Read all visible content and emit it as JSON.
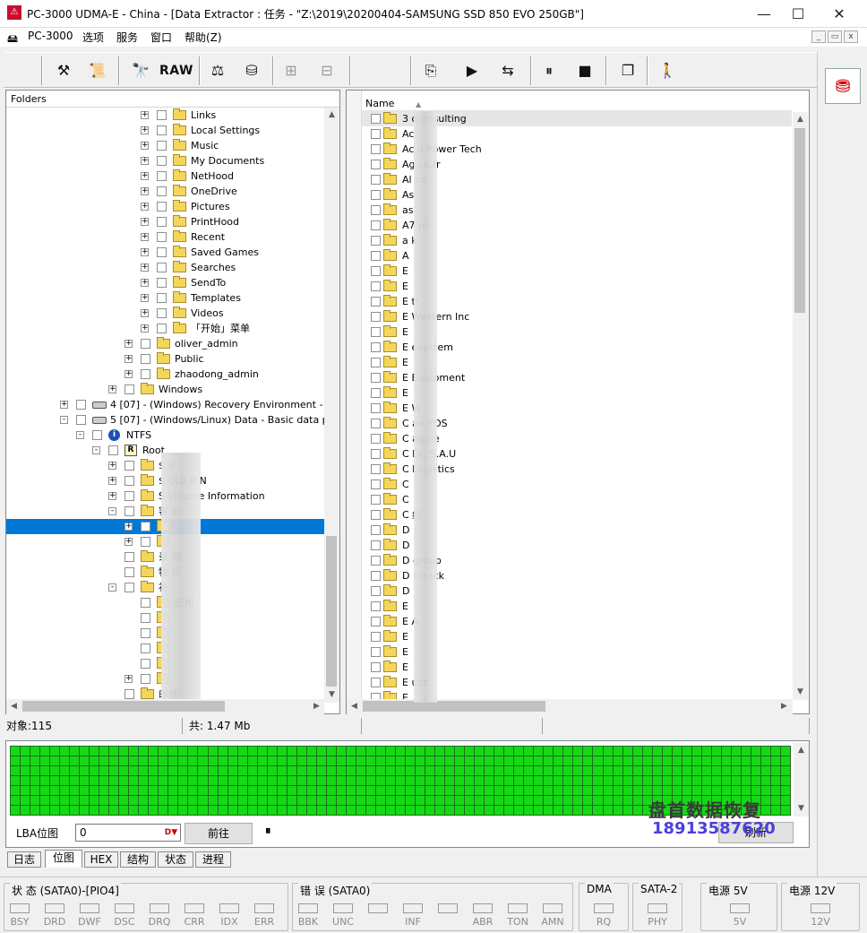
{
  "window": {
    "title": "PC-3000 UDMA-E - China - [Data Extractor : 任务 - \"Z:\\2019\\20200404-SAMSUNG SSD 850 EVO 250GB\"]",
    "minimize": "—",
    "maximize": "☐",
    "close": "✕"
  },
  "menu": {
    "items": [
      "PC-3000",
      "选项",
      "服务",
      "窗口",
      "帮助(Z)"
    ],
    "mdi_minimize": "_",
    "mdi_restore": "▭",
    "mdi_close": "x"
  },
  "toolbar": {
    "raw_label": "RAW"
  },
  "folders": {
    "header": "Folders",
    "rows": [
      {
        "label": "Links"
      },
      {
        "label": "Local Settings"
      },
      {
        "label": "Music"
      },
      {
        "label": "My Documents"
      },
      {
        "label": "NetHood"
      },
      {
        "label": "OneDrive"
      },
      {
        "label": "Pictures"
      },
      {
        "label": "PrintHood"
      },
      {
        "label": "Recent"
      },
      {
        "label": "Saved Games"
      },
      {
        "label": "Searches"
      },
      {
        "label": "SendTo"
      },
      {
        "label": "Templates"
      },
      {
        "label": "Videos"
      },
      {
        "label": "「开始」菜单"
      },
      {
        "label": "oliver_admin"
      },
      {
        "label": "Public"
      },
      {
        "label": "zhaodong_admin"
      },
      {
        "label": "Windows"
      },
      {
        "label": "4 [07] - (Windows) Recovery Environment -"
      },
      {
        "label": "5 [07] - (Windows/Linux) Data - Basic data partition"
      },
      {
        "label": "NTFS"
      },
      {
        "label": "Root"
      },
      {
        "label": "$    d"
      },
      {
        "label": "$      CLE.BIN"
      },
      {
        "label": "S      Volume Information"
      },
      {
        "label": "客      价"
      },
      {
        "label": ""
      },
      {
        "label": ""
      },
      {
        "label": "录     频"
      },
      {
        "label": "牧     片"
      },
      {
        "label": "补"
      },
      {
        "label": "       应用"
      },
      {
        "label": ""
      },
      {
        "label": ""
      },
      {
        "label": ""
      },
      {
        "label": ""
      },
      {
        "label": ""
      },
      {
        "label": "邮件"
      }
    ]
  },
  "files": {
    "column_name": "Name",
    "rows": [
      "3 d      onsulting",
      "Ac",
      "Ac        d Power Tech",
      "Ag        co.fr",
      "Al        ps",
      "As",
      "as",
      "A7        ps",
      "a        k",
      "A",
      "E",
      "E",
      "E        tt",
      "E        Western Inc",
      "E",
      "E        esystem",
      "E",
      "E        Equipment",
      "E",
      "E        W",
      "C        an POS",
      "C        agine",
      "C        DC S.A.U",
      "C        Logistics",
      "C",
      "C",
      "C        约",
      "D",
      "D",
      "D        group",
      "D        htrack",
      "D",
      "E",
      "E        A",
      "E",
      "E",
      "E",
      "E        uzz",
      "E"
    ]
  },
  "status": {
    "objects": "对象:115",
    "total": "共:  1.47 Mb"
  },
  "bitmap": {
    "lba_label": "LBA位图",
    "lba_value": "0",
    "go_button": "前往",
    "right_button": "刷新",
    "pause": "⏸",
    "cell_color": "#16d916"
  },
  "watermark": {
    "line1": "盘首数据恢复",
    "line2": "18913587620"
  },
  "tabs": [
    "日志",
    "位图",
    "HEX",
    "结构",
    "状态",
    "进程"
  ],
  "indicators": {
    "status_title": "状 态 (SATA0)-[PIO4]",
    "status_leds": [
      "BSY",
      "DRD",
      "DWF",
      "DSC",
      "DRQ",
      "CRR",
      "IDX",
      "ERR"
    ],
    "error_title": "错 误 (SATA0)",
    "error_leds": [
      "BBK",
      "UNC",
      "",
      "INF",
      "",
      "ABR",
      "TON",
      "AMN"
    ],
    "dma_title": "DMA",
    "dma_led": "RQ",
    "sata_title": "SATA-2",
    "sata_led": "PHY",
    "p5_title": "电源 5V",
    "p5_led": "5V",
    "p12_title": "电源 12V",
    "p12_led": "12V"
  }
}
